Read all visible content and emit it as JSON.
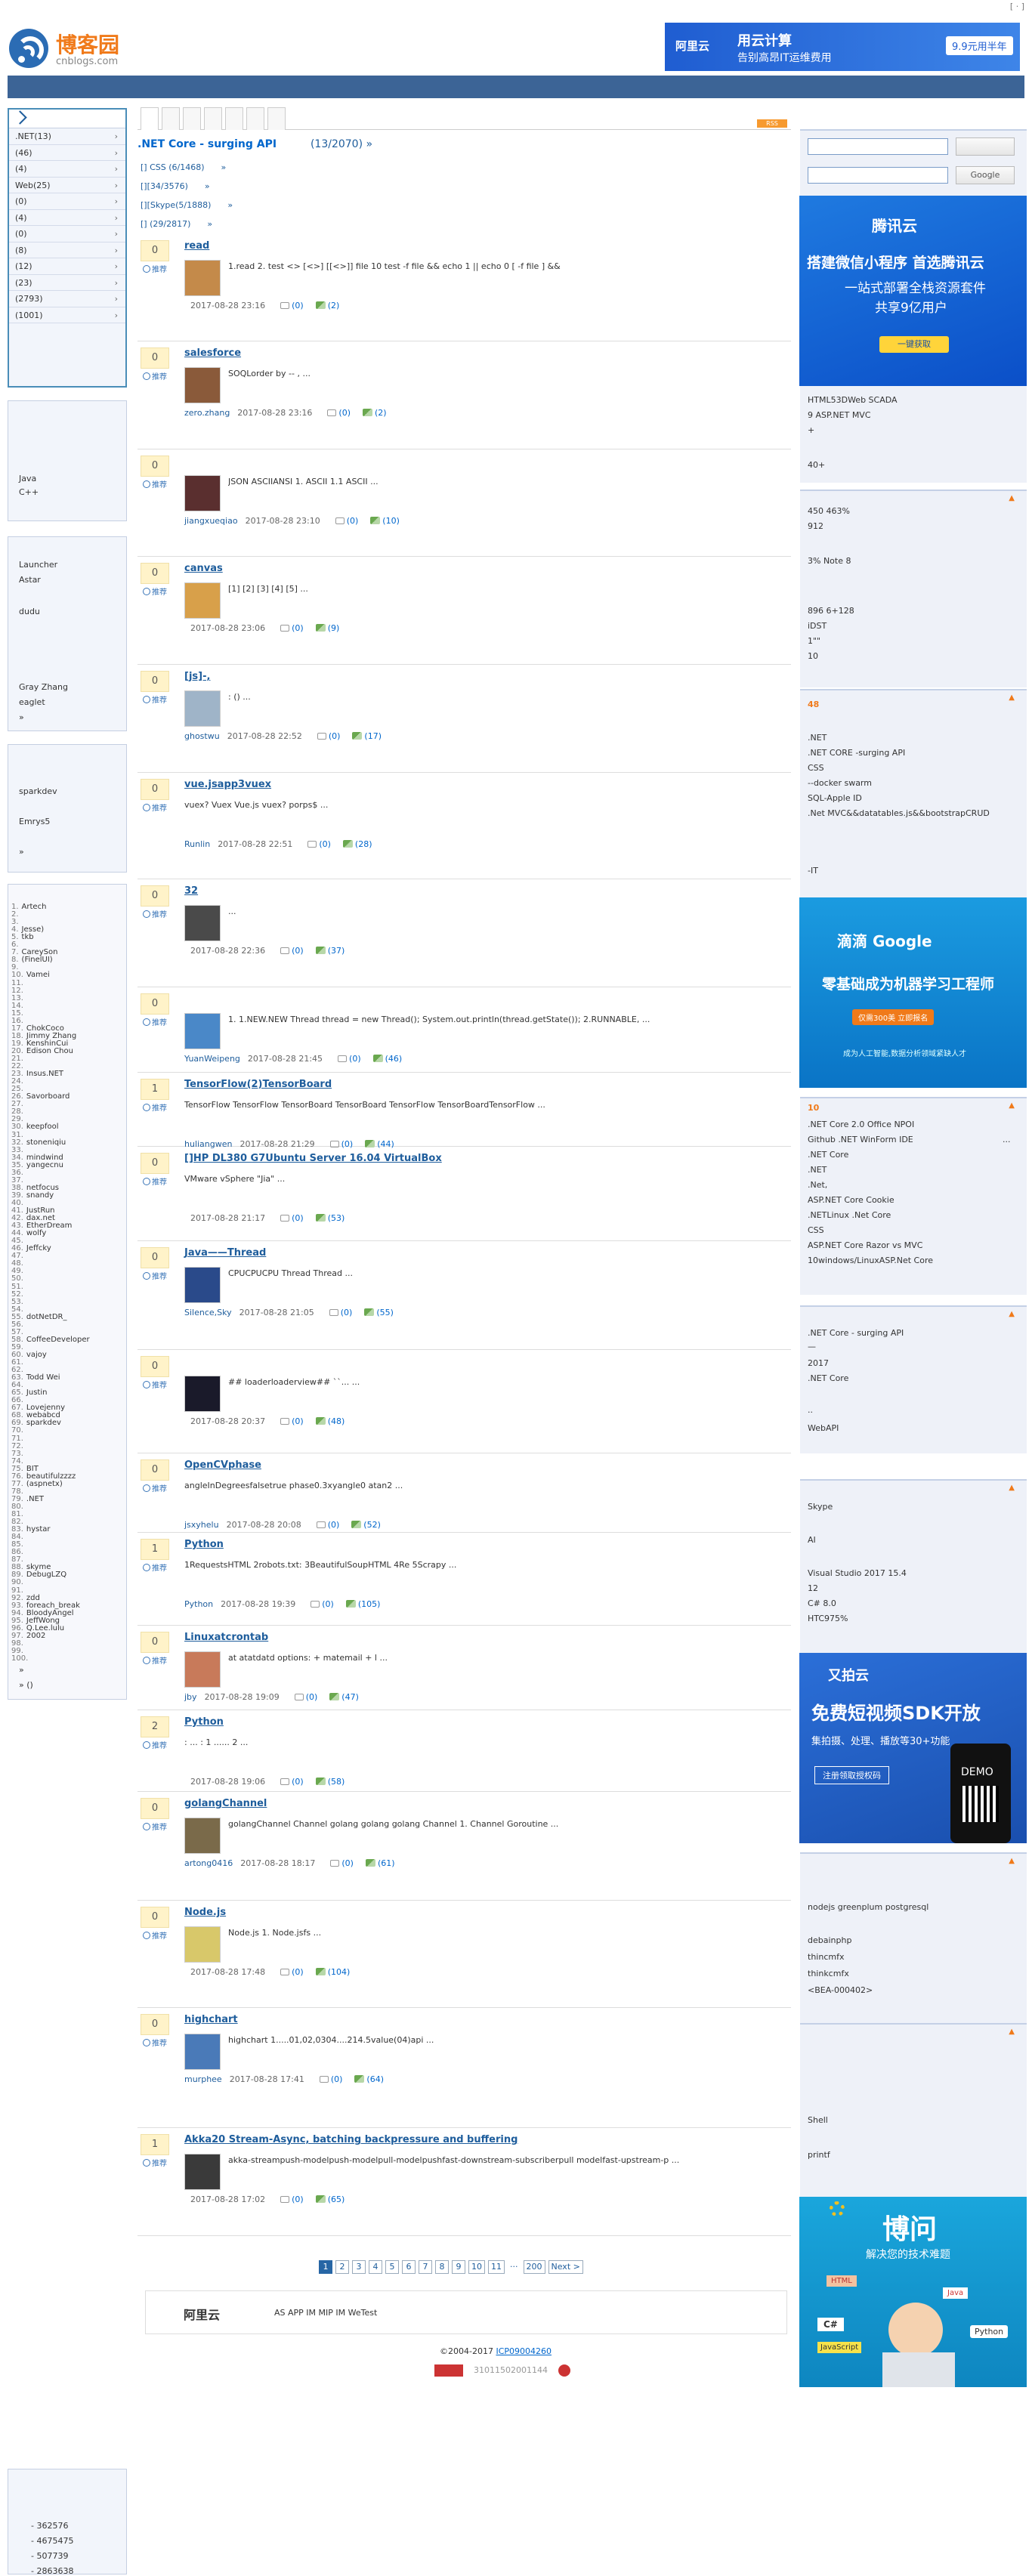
{
  "topbar": {
    "link": "[ · ]"
  },
  "header": {
    "logo_name": "博客园",
    "logo_url": "cnblogs.com",
    "banner_brand": "阿里云",
    "banner_title": "用云计算",
    "banner_sub": "告别高昂IT运维费用",
    "banner_btn": "9.9元用半年"
  },
  "categories": [
    ".NET(13)",
    "(46)",
    "(4)",
    "Web(25)",
    "(0)",
    "(4)",
    "(0)",
    "(8)",
    "(12)",
    "(23)",
    "(2793)",
    "(1001)"
  ],
  "left_blocks": {
    "b2": [
      "Java",
      "C++"
    ],
    "b3": [
      "Launcher",
      "Astar",
      "dudu",
      "Gray Zhang",
      "eaglet",
      "»"
    ],
    "b4": [
      "sparkdev",
      "Emrys5",
      "»"
    ],
    "ranking": [
      {
        "n": "1.",
        "name": "Artech"
      },
      {
        "n": "2.",
        "name": ""
      },
      {
        "n": "3.",
        "name": ""
      },
      {
        "n": "4.",
        "name": "Jesse)"
      },
      {
        "n": "5.",
        "name": "tkb"
      },
      {
        "n": "6.",
        "name": ""
      },
      {
        "n": "7.",
        "name": "CareySon"
      },
      {
        "n": "8.",
        "name": "(FinelUI)"
      },
      {
        "n": "9.",
        "name": ""
      },
      {
        "n": "10.",
        "name": "Vamei"
      },
      {
        "n": "11.",
        "name": ""
      },
      {
        "n": "12.",
        "name": ""
      },
      {
        "n": "13.",
        "name": ""
      },
      {
        "n": "14.",
        "name": ""
      },
      {
        "n": "15.",
        "name": ""
      },
      {
        "n": "16.",
        "name": ""
      },
      {
        "n": "17.",
        "name": "ChokCoco"
      },
      {
        "n": "18.",
        "name": "Jimmy Zhang"
      },
      {
        "n": "19.",
        "name": "KenshinCui"
      },
      {
        "n": "20.",
        "name": "Edison Chou"
      },
      {
        "n": "21.",
        "name": ""
      },
      {
        "n": "22.",
        "name": ""
      },
      {
        "n": "23.",
        "name": "Insus.NET"
      },
      {
        "n": "24.",
        "name": ""
      },
      {
        "n": "25.",
        "name": ""
      },
      {
        "n": "26.",
        "name": "Savorboard"
      },
      {
        "n": "27.",
        "name": ""
      },
      {
        "n": "28.",
        "name": ""
      },
      {
        "n": "29.",
        "name": ""
      },
      {
        "n": "30.",
        "name": "keepfool"
      },
      {
        "n": "31.",
        "name": ""
      },
      {
        "n": "32.",
        "name": "stoneniqiu"
      },
      {
        "n": "33.",
        "name": ""
      },
      {
        "n": "34.",
        "name": "mindwind"
      },
      {
        "n": "35.",
        "name": "yangecnu"
      },
      {
        "n": "36.",
        "name": ""
      },
      {
        "n": "37.",
        "name": ""
      },
      {
        "n": "38.",
        "name": "netfocus"
      },
      {
        "n": "39.",
        "name": "snandy"
      },
      {
        "n": "40.",
        "name": ""
      },
      {
        "n": "41.",
        "name": "JustRun"
      },
      {
        "n": "42.",
        "name": "dax.net"
      },
      {
        "n": "43.",
        "name": "EtherDream"
      },
      {
        "n": "44.",
        "name": "wolfy"
      },
      {
        "n": "45.",
        "name": ""
      },
      {
        "n": "46.",
        "name": "Jeffcky"
      },
      {
        "n": "47.",
        "name": ""
      },
      {
        "n": "48.",
        "name": ""
      },
      {
        "n": "49.",
        "name": ""
      },
      {
        "n": "50.",
        "name": ""
      },
      {
        "n": "51.",
        "name": ""
      },
      {
        "n": "52.",
        "name": ""
      },
      {
        "n": "53.",
        "name": ""
      },
      {
        "n": "54.",
        "name": ""
      },
      {
        "n": "55.",
        "name": "dotNetDR_"
      },
      {
        "n": "56.",
        "name": ""
      },
      {
        "n": "57.",
        "name": ""
      },
      {
        "n": "58.",
        "name": "CoffeeDeveloper"
      },
      {
        "n": "59.",
        "name": ""
      },
      {
        "n": "60.",
        "name": "vajoy"
      },
      {
        "n": "61.",
        "name": ""
      },
      {
        "n": "62.",
        "name": ""
      },
      {
        "n": "63.",
        "name": "Todd Wei"
      },
      {
        "n": "64.",
        "name": ""
      },
      {
        "n": "65.",
        "name": "Justin"
      },
      {
        "n": "66.",
        "name": ""
      },
      {
        "n": "67.",
        "name": "Lovejenny"
      },
      {
        "n": "68.",
        "name": "webabcd"
      },
      {
        "n": "69.",
        "name": "sparkdev"
      },
      {
        "n": "70.",
        "name": ""
      },
      {
        "n": "71.",
        "name": ""
      },
      {
        "n": "72.",
        "name": ""
      },
      {
        "n": "73.",
        "name": ""
      },
      {
        "n": "74.",
        "name": ""
      },
      {
        "n": "75.",
        "name": "BIT"
      },
      {
        "n": "76.",
        "name": "beautifulzzzz"
      },
      {
        "n": "77.",
        "name": "(aspnetx)"
      },
      {
        "n": "78.",
        "name": ""
      },
      {
        "n": "79.",
        "name": ".NET"
      },
      {
        "n": "80.",
        "name": ""
      },
      {
        "n": "81.",
        "name": ""
      },
      {
        "n": "82.",
        "name": ""
      },
      {
        "n": "83.",
        "name": "hystar"
      },
      {
        "n": "84.",
        "name": ""
      },
      {
        "n": "85.",
        "name": ""
      },
      {
        "n": "86.",
        "name": ""
      },
      {
        "n": "87.",
        "name": ""
      },
      {
        "n": "88.",
        "name": "skyme"
      },
      {
        "n": "89.",
        "name": "DebugLZQ"
      },
      {
        "n": "90.",
        "name": ""
      },
      {
        "n": "91.",
        "name": ""
      },
      {
        "n": "92.",
        "name": "zdd"
      },
      {
        "n": "93.",
        "name": "foreach_break"
      },
      {
        "n": "94.",
        "name": "BloodyAngel"
      },
      {
        "n": "95.",
        "name": "JeffWong"
      },
      {
        "n": "96.",
        "name": "Q.Lee.lulu"
      },
      {
        "n": "97.",
        "name": "2002"
      },
      {
        "n": "98.",
        "name": ""
      },
      {
        "n": "99.",
        "name": ""
      },
      {
        "n": "100.",
        "name": ""
      }
    ],
    "ranking_more": "»",
    "ranking_more2": "» ()",
    "stats": [
      "- 362576",
      "- 4675475",
      "- 507739",
      "- 2863638"
    ]
  },
  "main": {
    "collection_title": ".NET Core - surging API",
    "pager_info": "(13/2070)",
    "pager_more": "»",
    "tags": [
      {
        "label": "[] CSS (6/1468)",
        "more": "»"
      },
      {
        "label": "[][34/3576)",
        "more": "»"
      },
      {
        "label": "[][Skype(5/1888)",
        "more": "»"
      },
      {
        "label": "[] (29/2817)",
        "more": "»"
      }
    ],
    "rec_label": "推荐",
    "posts": [
      {
        "title": "read",
        "votes": "0",
        "summary": "1.read 2.  test <> [<>]  [[<>]] file 10 test -f file && echo 1 || echo 0 [ -f file ] &&",
        "author": "",
        "time": "2017-08-28 23:16",
        "comments": "(0)",
        "views": "(2)",
        "av": "#c48a4a"
      },
      {
        "title": "salesforce",
        "votes": "0",
        "summary": "SOQLorder by -- , ...",
        "author": "zero.zhang",
        "time": "2017-08-28 23:16",
        "comments": "(0)",
        "views": "(2)",
        "av": "#8a5a3a"
      },
      {
        "title": "",
        "votes": "0",
        "summary": "JSON  ASCIIANSI  1. ASCII 1.1 ASCII  ...",
        "author": "jiangxueqiao",
        "time": "2017-08-28 23:10",
        "comments": "(0)",
        "views": "(10)",
        "av": "#5a2f2f"
      },
      {
        "title": "canvas",
        "votes": "0",
        "summary": "[1] [2] [3] [4] [5] ...",
        "author": "",
        "time": "2017-08-28 23:06",
        "comments": "(0)",
        "views": "(9)",
        "av": "#d8a04a"
      },
      {
        "title": "[js]-,",
        "votes": "0",
        "summary": ":  () ...",
        "author": "ghostwu",
        "time": "2017-08-28 22:52",
        "comments": "(0)",
        "views": "(17)",
        "av": "#9fb4c8"
      },
      {
        "title": "vue.jsapp3vuex",
        "votes": "0",
        "summary": "vuex? Vuex  Vue.js     vuex? porps$ ...",
        "author": "Runlin",
        "time": "2017-08-28 22:51",
        "comments": "(0)",
        "views": "(28)",
        "av": ""
      },
      {
        "title": "32",
        "votes": "0",
        "summary": "...",
        "author": "",
        "time": "2017-08-28 22:36",
        "comments": "(0)",
        "views": "(37)",
        "av": "#4a4a4a"
      },
      {
        "title": "",
        "votes": "0",
        "summary": "1.  1.NEW.NEW Thread thread = new Thread(); System.out.println(thread.getState()); 2.RUNNABLE, ...",
        "author": "YuanWeipeng",
        "time": "2017-08-28 21:45",
        "comments": "(0)",
        "views": "(46)",
        "av": "#4a88c8"
      },
      {
        "title": "TensorFlow(2)TensorBoard",
        "votes": "1",
        "summary": "TensorFlow TensorFlow TensorBoard  TensorBoard  TensorFlow  TensorBoardTensorFlow ...",
        "author": "huliangwen",
        "time": "2017-08-28 21:29",
        "comments": "(0)",
        "views": "(44)",
        "av": ""
      },
      {
        "title": "[]HP DL380 G7Ubuntu Server 16.04  VirtualBox",
        "votes": "0",
        "summary": "VMware vSphere \"Jia\"  ...",
        "author": "",
        "time": "2017-08-28 21:17",
        "comments": "(0)",
        "views": "(53)",
        "av": ""
      },
      {
        "title": "Java——Thread",
        "votes": "0",
        "summary": "CPUCPUCPU  Thread Thread ...",
        "author": "Silence,Sky",
        "time": "2017-08-28 21:05",
        "comments": "(0)",
        "views": "(55)",
        "av": "#2a4a8a"
      },
      {
        "title": "",
        "votes": "0",
        "summary": "## loaderloaderview## ``... ...",
        "author": "",
        "time": "2017-08-28 20:37",
        "comments": "(0)",
        "views": "(48)",
        "av": "#1a1a2a"
      },
      {
        "title": "OpenCVphase",
        "votes": "0",
        "summary": "angleInDegreesfalsetrue phase0.3xyangle0 atan2  ...",
        "author": "jsxyhelu",
        "time": "2017-08-28 20:08",
        "comments": "(0)",
        "views": "(52)",
        "av": ""
      },
      {
        "title": "Python",
        "votes": "1",
        "summary": "1RequestsHTML 2robots.txt: 3BeautifulSoupHTML 4Re 5Scrapy ...",
        "author": "Python",
        "time": "2017-08-28 19:39",
        "comments": "(0)",
        "views": "(105)",
        "av": ""
      },
      {
        "title": "Linuxatcrontab",
        "votes": "0",
        "summary": "at  atatdatd   options: + matemail + l ...",
        "author": "jby",
        "time": "2017-08-28 19:09",
        "comments": "(0)",
        "views": "(47)",
        "av": "#c87a5a"
      },
      {
        "title": "Python",
        "votes": "2",
        "summary": ": ... : 1 ...... 2 ...",
        "author": "",
        "time": "2017-08-28 19:06",
        "comments": "(0)",
        "views": "(58)",
        "av": ""
      },
      {
        "title": "golangChannel",
        "votes": "0",
        "summary": "golangChannel Channel  golang  golang  golang Channel 1.   Channel  Goroutine   ...",
        "author": "artong0416",
        "time": "2017-08-28 18:17",
        "comments": "(0)",
        "views": "(61)",
        "av": "#7a6a4a"
      },
      {
        "title": "Node.js",
        "votes": "0",
        "summary": "Node.js 1.  Node.jsfs ...",
        "author": "",
        "time": "2017-08-28 17:48",
        "comments": "(0)",
        "views": "(104)",
        "av": "#d8c86a"
      },
      {
        "title": "highchart",
        "votes": "0",
        "summary": "highchart 1.....01,02,0304....214.5value(04)api ...",
        "author": "murphee",
        "time": "2017-08-28 17:41",
        "comments": "(0)",
        "views": "(64)",
        "av": "#4a7ab8"
      },
      {
        "title": "Akka20 Stream-Async, batching backpressure and buffering",
        "votes": "1",
        "summary": "akka-streampush-modelpush-modelpull-modelpushfast-downstream-subscriberpull modelfast-upstream-p ...",
        "author": "",
        "time": "2017-08-28 17:02",
        "comments": "(0)",
        "views": "(65)",
        "av": "#3a3a3a"
      }
    ],
    "pager": [
      "1",
      "2",
      "3",
      "4",
      "5",
      "6",
      "7",
      "8",
      "9",
      "10",
      "11",
      "···",
      "200",
      "Next >"
    ],
    "footad_logo": "阿里云",
    "footad_text": "AS    APP  IM      MIP   IM   WeTest",
    "copyright": "©2004-2017",
    "icp": "ICP09004260",
    "beian": "31011502001144"
  },
  "right": {
    "search_btn2": "Google",
    "ad1_brand": "腾讯云",
    "ad1_title": "搭建微信小程序 首选腾讯云",
    "ad1_sub": "一站式部署全栈资源套件",
    "ad1_sub2": "共享9亿用户",
    "ad1_btn": "一键获取",
    "box1": [
      "HTML53DWeb SCADA",
      "9  ASP.NET MVC",
      "+",
      "40+"
    ],
    "box2": [
      "450 463%",
      "912",
      "3% Note 8",
      "896 6+128",
      "iDST",
      "1\"\"",
      "10"
    ],
    "box3": [
      "48",
      ".NET",
      ".NET CORE -surging API",
      " CSS",
      "--docker swarm",
      "SQL-Apple ID",
      ".Net MVC&&datatables.js&&bootstrapCRUD",
      "-IT"
    ],
    "ad2_brand": "滴滴  Google",
    "ad2_title": "零基础成为机器学习工程师",
    "ad2_btn": "仅需300美   立即报名",
    "ad2_sub": "成为人工智能,数据分析领域紧缺人才",
    "box4": [
      "10",
      ".NET Core 2.0 Office NPOI",
      "Github  .NET WinForm  IDE",
      "...",
      ".NET Core",
      ".NET",
      ".Net,",
      "ASP.NET Core Cookie",
      ".NETLinux .Net Core",
      "CSS",
      "ASP.NET Core Razor vs MVC",
      "10windows/LinuxASP.Net Core"
    ],
    "box5": [
      ".NET Core - surging API",
      "—",
      "2017",
      ".NET Core",
      "..",
      "WebAPI"
    ],
    "box6": [
      "Skype",
      "AI",
      "Visual Studio 2017 15.4",
      "12",
      "C# 8.0",
      "HTC975%"
    ],
    "ad3_brand": "又拍云",
    "ad3_title": "免费短视频SDK开放",
    "ad3_sub": "集拍摄、处理、播放等30+功能",
    "ad3_btn": "注册领取授权码",
    "ad3_demo": "DEMO",
    "box7": [
      "nodejs greenplum postgresql",
      "debainphp",
      "thincmfx",
      "thinkcmfx",
      "<BEA-000402>"
    ],
    "box8": [
      "Shell",
      "printf"
    ],
    "ad4_title": "博问",
    "ad4_sub": "解决您的技术难题",
    "ad4_tags": [
      "HTML",
      "Java",
      "C#",
      "JavaScript",
      "Python"
    ]
  },
  "colors": {
    "nav": "#3c6496",
    "accent": "#1e5d9c",
    "orange": "#f07a1a"
  }
}
